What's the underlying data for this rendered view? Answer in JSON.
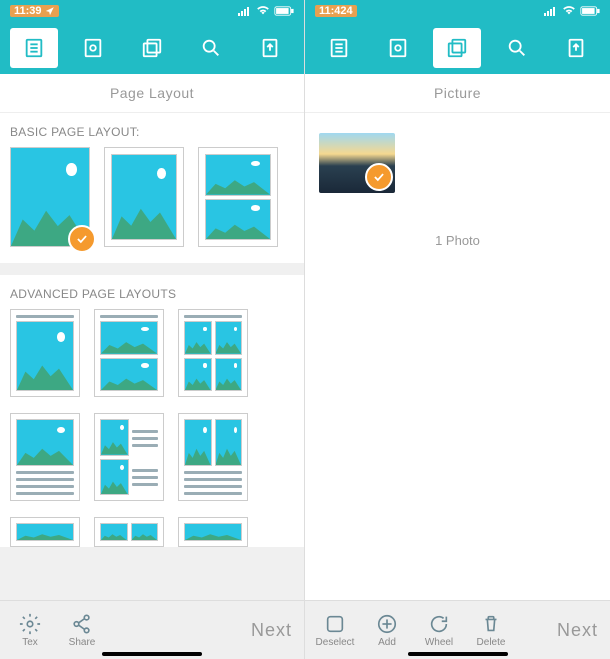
{
  "left": {
    "time": "11:39",
    "title": "Page Layout",
    "section_basic": "BASIC PAGE LAYOUT:",
    "section_advanced": "ADVANCED PAGE LAYOUTS",
    "bottom": {
      "text": "Tex",
      "share": "Share",
      "next": "Next"
    }
  },
  "right": {
    "time": "11:424",
    "title": "Picture",
    "photo_count": "1 Photo",
    "bottom": {
      "deselect": "Deselect",
      "add": "Add",
      "wheel": "Wheel",
      "delete": "Delete",
      "next": "Next"
    }
  }
}
